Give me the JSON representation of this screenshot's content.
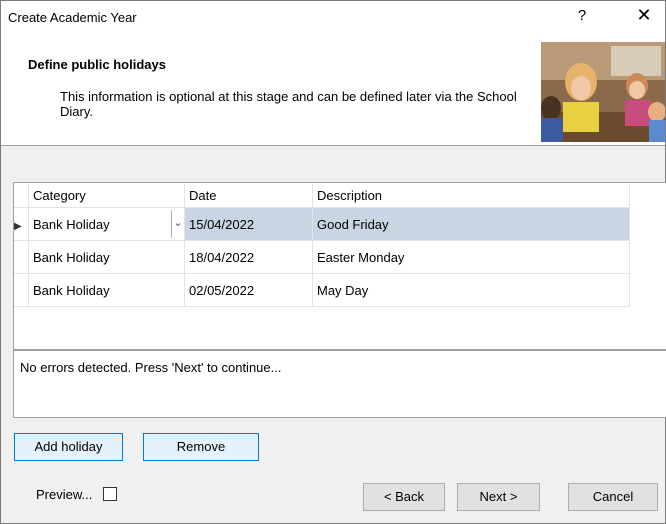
{
  "window": {
    "title": "Create Academic Year",
    "help_glyph": "?",
    "close_glyph": "✕"
  },
  "header": {
    "title": "Define public holidays",
    "description": "This information is optional at this stage and can be defined later via the School Diary."
  },
  "grid": {
    "columns": [
      "Category",
      "Date",
      "Description"
    ],
    "rows": [
      {
        "category": "Bank Holiday",
        "date": "15/04/2022",
        "description": "Good Friday"
      },
      {
        "category": "Bank Holiday",
        "date": "18/04/2022",
        "description": "Easter Monday"
      },
      {
        "category": "Bank Holiday",
        "date": "02/05/2022",
        "description": "May Day"
      }
    ],
    "selected_row_color": "#c9d5e3"
  },
  "status": {
    "message": "No errors detected. Press 'Next' to continue..."
  },
  "actions": {
    "add_label": "Add holiday",
    "remove_label": "Remove"
  },
  "footer": {
    "preview_label": "Preview...",
    "back_label": "< Back",
    "next_label": "Next >",
    "cancel_label": "Cancel"
  },
  "colors": {
    "focus_border": "#0078d7"
  }
}
